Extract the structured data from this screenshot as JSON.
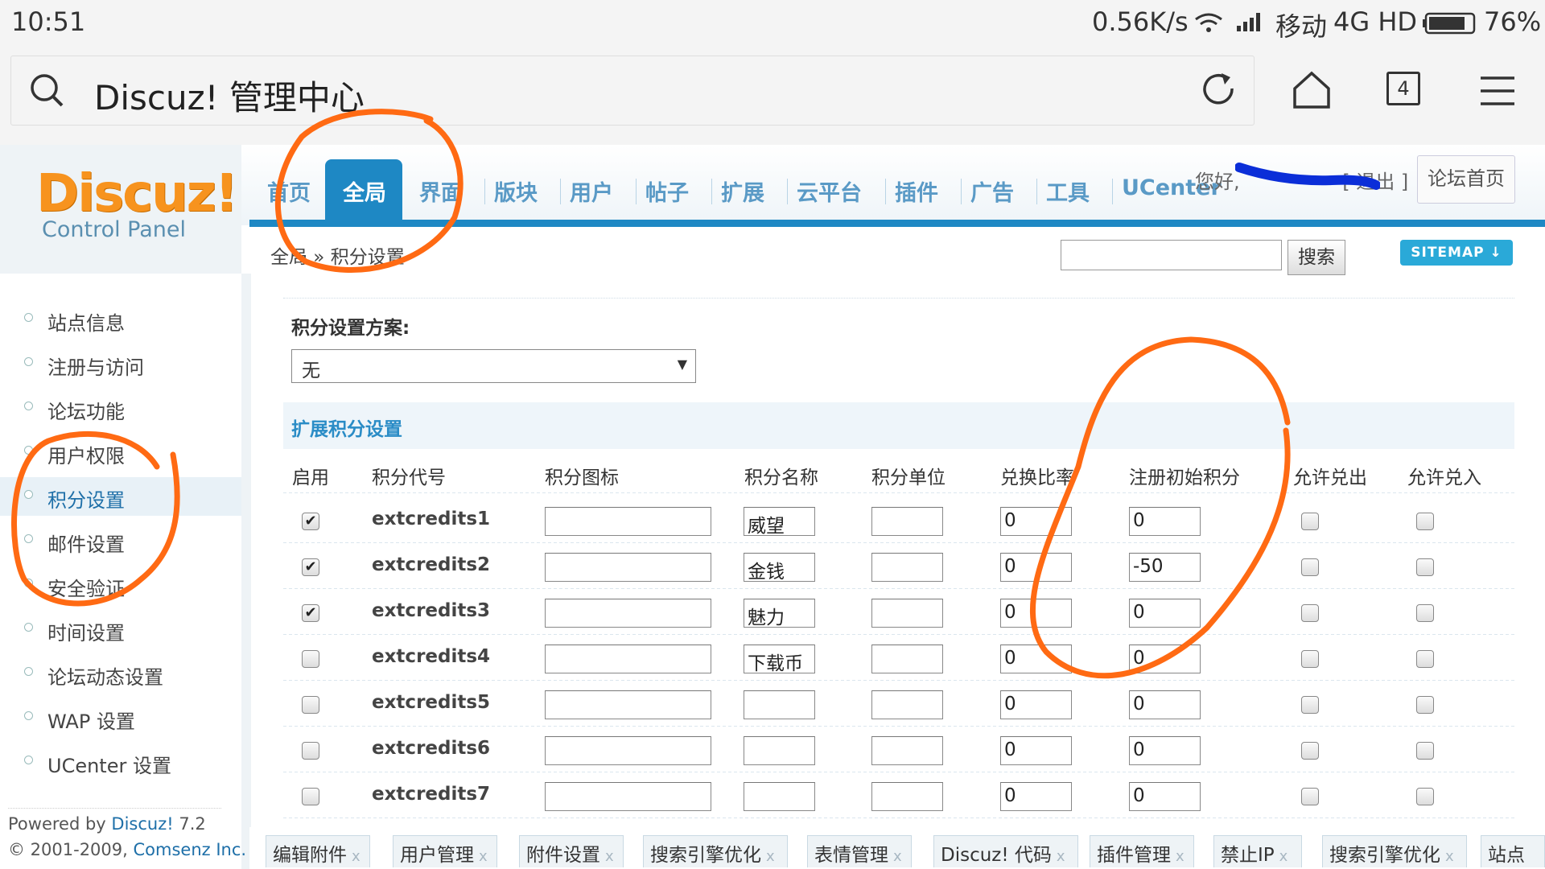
{
  "status_bar": {
    "time": "10:51",
    "speed": "0.56K/s",
    "carrier": "移动",
    "network": "4G HD",
    "battery": "76%"
  },
  "browser": {
    "title": "Discuz! 管理中心",
    "tab_count": "4",
    "icons": [
      "search-icon",
      "reload-icon",
      "home-icon",
      "tabs-icon",
      "menu-icon"
    ]
  },
  "logo": {
    "name": "Discuz!",
    "subtitle": "Control Panel"
  },
  "nav": {
    "tabs": [
      "首页",
      "全局",
      "界面",
      "版块",
      "用户",
      "帖子",
      "扩展",
      "云平台",
      "插件",
      "广告",
      "工具",
      "UCenter"
    ],
    "active": "全局",
    "greeting": "您好, ",
    "logout": "[ 退出 ]",
    "forum_home": "论坛首页"
  },
  "breadcrumb": "全局 » 积分设置",
  "search": {
    "value": "",
    "button": "搜索"
  },
  "sitemap": "SITEMAP",
  "sidebar": {
    "items": [
      "站点信息",
      "注册与访问",
      "论坛功能",
      "用户权限",
      "积分设置",
      "邮件设置",
      "安全验证",
      "时间设置",
      "论坛动态设置",
      "WAP 设置",
      "UCenter 设置"
    ],
    "active": "积分设置",
    "powered_by": "Powered by",
    "product": "Discuz!",
    "version": "7.2",
    "copyright": "© 2001-2009,",
    "company": "Comsenz Inc."
  },
  "scheme": {
    "label": "积分设置方案:",
    "selected": "无"
  },
  "section_title": "扩展积分设置",
  "table": {
    "headers": [
      "启用",
      "积分代号",
      "积分图标",
      "积分名称",
      "积分单位",
      "兑换比率",
      "注册初始积分",
      "允许兑出",
      "允许兑入"
    ],
    "rows": [
      {
        "enabled": true,
        "code": "extcredits1",
        "icon": "",
        "name": "威望",
        "unit": "",
        "ratio": "0",
        "initial": "0",
        "allow_out": false,
        "allow_in": false
      },
      {
        "enabled": true,
        "code": "extcredits2",
        "icon": "",
        "name": "金钱",
        "unit": "",
        "ratio": "0",
        "initial": "-50",
        "allow_out": false,
        "allow_in": false
      },
      {
        "enabled": true,
        "code": "extcredits3",
        "icon": "",
        "name": "魅力",
        "unit": "",
        "ratio": "0",
        "initial": "0",
        "allow_out": false,
        "allow_in": false
      },
      {
        "enabled": false,
        "code": "extcredits4",
        "icon": "",
        "name": "下载币",
        "unit": "",
        "ratio": "0",
        "initial": "0",
        "allow_out": false,
        "allow_in": false
      },
      {
        "enabled": false,
        "code": "extcredits5",
        "icon": "",
        "name": "",
        "unit": "",
        "ratio": "0",
        "initial": "0",
        "allow_out": false,
        "allow_in": false
      },
      {
        "enabled": false,
        "code": "extcredits6",
        "icon": "",
        "name": "",
        "unit": "",
        "ratio": "0",
        "initial": "0",
        "allow_out": false,
        "allow_in": false
      },
      {
        "enabled": false,
        "code": "extcredits7",
        "icon": "",
        "name": "",
        "unit": "",
        "ratio": "0",
        "initial": "0",
        "allow_out": false,
        "allow_in": false
      }
    ]
  },
  "bottom_tabs": [
    "编辑附件",
    "用户管理",
    "附件设置",
    "搜索引擎优化",
    "表情管理",
    "Discuz! 代码",
    "插件管理",
    "禁止IP",
    "搜索引擎优化",
    "站点"
  ],
  "colors": {
    "accent": "#1e88c4",
    "annotation": "#ff6a13",
    "nav_text": "#5a9ac6",
    "active_tab": "#1e88c4"
  }
}
